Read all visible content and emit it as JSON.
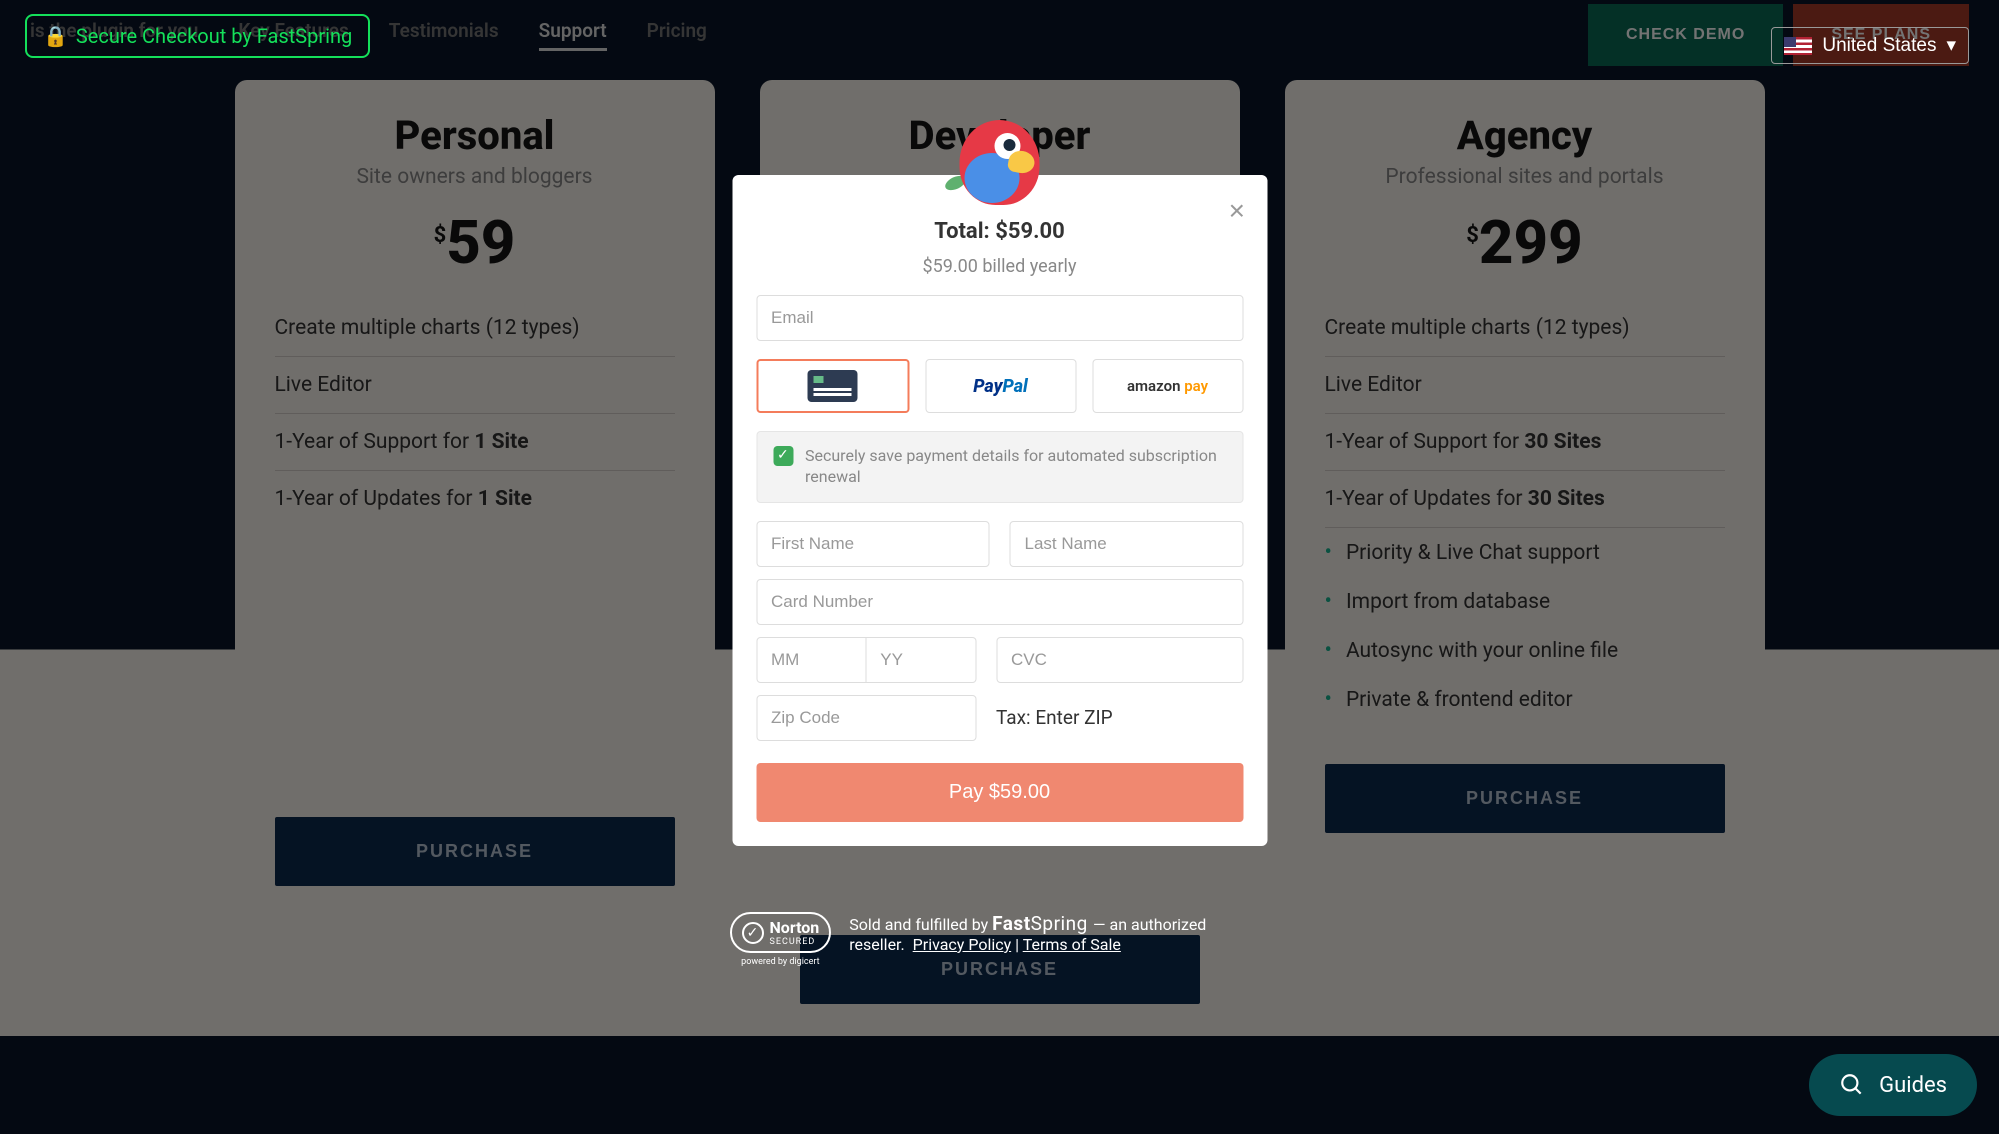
{
  "secure_badge": "Secure Checkout by FastSpring",
  "country": "United States",
  "nav": {
    "tagline": "is the plugin for you",
    "links": [
      "Key Features",
      "Testimonials",
      "Support",
      "Pricing"
    ],
    "active_index": 2,
    "demo_btn": "CHECK DEMO",
    "plans_btn": "SEE PLANS"
  },
  "plans": [
    {
      "name": "Personal",
      "sub": "Site owners and bloggers",
      "currency": "$",
      "price": "59",
      "features": [
        "Create multiple charts (12 types)",
        "Live Editor",
        "1-Year of Support for <strong>1 Site</strong>",
        "1-Year of Updates for <strong>1 Site</strong>"
      ],
      "extras": [],
      "cta": "PURCHASE"
    },
    {
      "name": "Developer",
      "sub": "",
      "currency": "$",
      "price": "",
      "features": [],
      "extras": [],
      "cta": "PURCHASE"
    },
    {
      "name": "Agency",
      "sub": "Professional sites and portals",
      "currency": "$",
      "price": "299",
      "features": [
        "Create multiple charts (12 types)",
        "Live Editor",
        "1-Year of Support for <strong>30 Sites</strong>",
        "1-Year of Updates for <strong>30 Sites</strong>"
      ],
      "extras": [
        "Priority & Live Chat support",
        "Import from database",
        "Autosync with your online file",
        "Private & frontend editor"
      ],
      "cta": "PURCHASE"
    }
  ],
  "modal": {
    "total_label": "Total:",
    "total_amount": "$59.00",
    "billing": "$59.00 billed yearly",
    "email_ph": "Email",
    "payment_methods": {
      "card": "card",
      "paypal": "PayPal",
      "amazon": "amazon pay",
      "selected": 0
    },
    "save_text": "Securely save payment details for automated subscription renewal",
    "save_checked": true,
    "first_name_ph": "First Name",
    "last_name_ph": "Last Name",
    "card_ph": "Card Number",
    "mm_ph": "MM",
    "yy_ph": "YY",
    "cvc_ph": "CVC",
    "zip_ph": "Zip Code",
    "tax_label": "Tax: Enter ZIP",
    "pay_btn": "Pay $59.00"
  },
  "trust": {
    "norton_label": "Norton",
    "norton_sub": "SECURED",
    "norton_powered": "powered by digicert",
    "text_1": "Sold and fulfilled by",
    "fastspring": "FastSpring",
    "text_2": "— an authorized reseller.",
    "privacy": "Privacy Policy",
    "sep": " | ",
    "terms": "Terms of Sale"
  },
  "guides_label": "Guides"
}
